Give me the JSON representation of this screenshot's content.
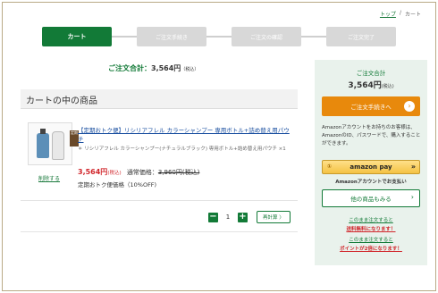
{
  "breadcrumb": {
    "home": "トップ",
    "separator": "/",
    "current": "カート"
  },
  "steps": [
    "カート",
    "ご注文手続き",
    "ご注文の確認",
    "ご注文完了"
  ],
  "summary": {
    "label": "ご注文合計：",
    "amount": "3,564円",
    "tax": "（税込）"
  },
  "cart": {
    "heading": "カートの中の商品",
    "item": {
      "badge": "定期",
      "name": "【定期おトク便】リシリアフレル カラーシャンプー 専用ボトル+詰め替え用パウチ",
      "variant": "＊ リシリアフレル カラーシャンプー(ナチュラルブラック) 専用ボトル+詰め替え用パウチ ×1",
      "delete": "削除する",
      "sale_price": "3,564円",
      "sale_tax": "(税込)",
      "regular_label": "通常価格：",
      "regular_price": "3,960円(税込)",
      "teiki": "定期おトク便価格（10%OFF)",
      "qty": "1",
      "minus": "−",
      "plus": "+",
      "recalc": "再計算 〉"
    }
  },
  "sidebar": {
    "total_label": "ご注文合計",
    "total_amount": "3,564円",
    "total_tax": "(税込)",
    "checkout": "ご注文手続きへ",
    "checkout_arrow": "›",
    "amazon_note": "Amazonアカウントをお持ちのお客様は、AmazonのID、パスワードで、購入することができます。",
    "amazon_pay": "amazon pay",
    "amazon_pay_icon": "①",
    "amazon_pay_arrow": "»",
    "amazon_sub": "Amazonアカウントでお支払い",
    "more": "他の商品もみる",
    "more_arrow": "›",
    "promo1_a": "このまま注文すると",
    "promo1_b": "送料無料になります！",
    "promo2_a": "このまま注文すると",
    "promo2_b": "ポイントが2倍になります！"
  }
}
